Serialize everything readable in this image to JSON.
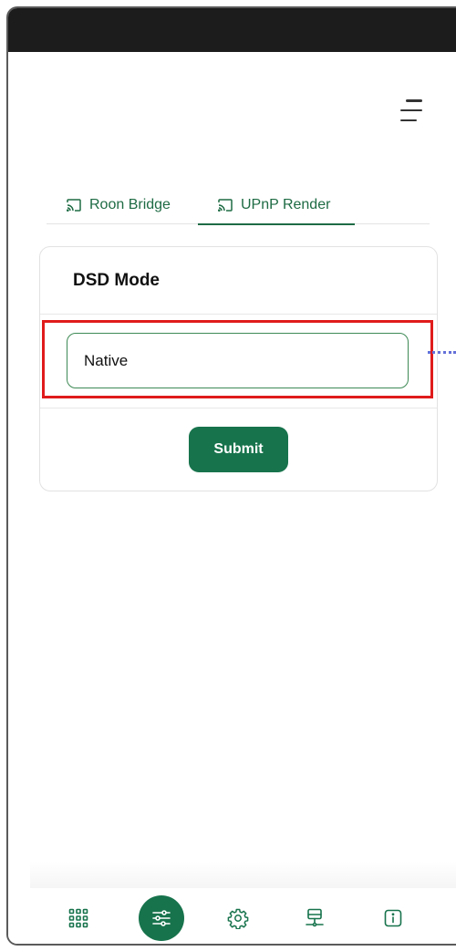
{
  "colors": {
    "accent": "#17734c",
    "tab_text": "#1e6b44",
    "highlight": "#e01b1b",
    "connector": "#6470d8"
  },
  "header": {
    "menu_icon": "hamburger-menu-icon"
  },
  "tabs": [
    {
      "label": "Roon Bridge",
      "icon": "cast-icon",
      "active": false
    },
    {
      "label": "UPnP Render",
      "icon": "cast-icon",
      "active": true
    }
  ],
  "dsd_card": {
    "title": "DSD Mode",
    "select_value": "Native",
    "submit_label": "Submit"
  },
  "bottom_nav": [
    {
      "name": "apps-grid",
      "icon": "grid-icon",
      "active": false
    },
    {
      "name": "equalizer",
      "icon": "sliders-icon",
      "active": true
    },
    {
      "name": "settings",
      "icon": "gear-icon",
      "active": false
    },
    {
      "name": "network",
      "icon": "network-icon",
      "active": false
    },
    {
      "name": "info",
      "icon": "info-icon",
      "active": false
    }
  ]
}
